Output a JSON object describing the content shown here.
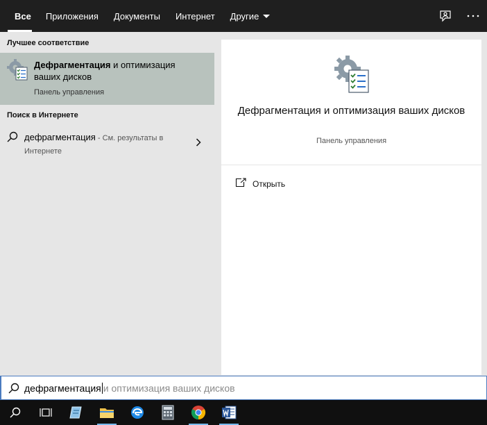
{
  "tabs": [
    {
      "label": "Все",
      "active": true
    },
    {
      "label": "Приложения"
    },
    {
      "label": "Документы"
    },
    {
      "label": "Интернет"
    },
    {
      "label": "Другие",
      "has_dropdown": true
    }
  ],
  "top_icons": [
    "feedback-icon",
    "more-icon"
  ],
  "best_match": {
    "section_label": "Лучшее соответствие",
    "title_bold": "Дефрагментация",
    "title_rest": " и оптимизация ваших дисков",
    "subtitle": "Панель управления",
    "icon": "defrag-icon"
  },
  "web_search": {
    "section_label": "Поиск в Интернете",
    "query": "дефрагментация",
    "hint": " - См. результаты в Интернете"
  },
  "detail": {
    "title": "Дефрагментация и оптимизация ваших дисков",
    "subtitle": "Панель управления",
    "open_label": "Открыть"
  },
  "search": {
    "typed": "дефрагментация",
    "suggestion": "и оптимизация ваших дисков"
  },
  "taskbar": {
    "items": [
      "search-icon",
      "task-view-icon",
      "notepad-icon",
      "file-explorer-icon",
      "edge-icon",
      "calculator-icon",
      "chrome-icon",
      "word-icon"
    ]
  },
  "colors": {
    "tab_bar": "#1f1f1f",
    "selected_item": "#b8c2bd",
    "left_panel": "#e6e6e6",
    "search_border": "#4a7bbf"
  }
}
